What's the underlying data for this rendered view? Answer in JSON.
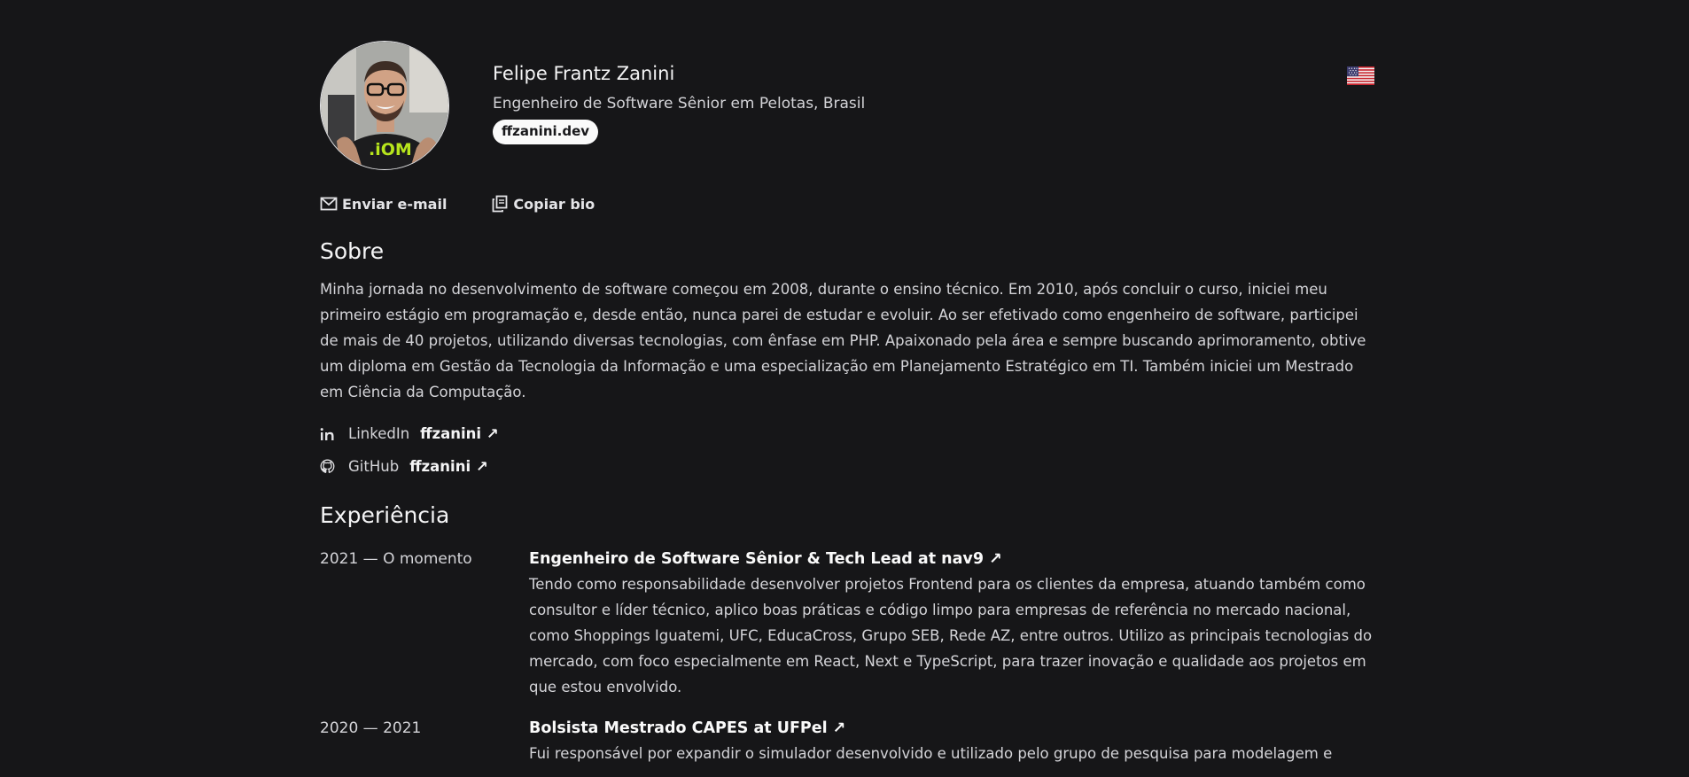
{
  "profile": {
    "name": "Felipe Frantz Zanini",
    "role": "Engenheiro de Software Sênior em Pelotas, Brasil",
    "site": "ffzanini.dev",
    "language_icon": "us-flag-icon"
  },
  "actions": {
    "email_label": "Enviar e-mail",
    "copy_label": "Copiar bio"
  },
  "about": {
    "title": "Sobre",
    "text": "Minha jornada no desenvolvimento de software começou em 2008, durante o ensino técnico. Em 2010, após concluir o curso, iniciei meu primeiro estágio em programação e, desde então, nunca parei de estudar e evoluir. Ao ser efetivado como engenheiro de software, participei de mais de 40 projetos, utilizando diversas tecnologias, com ênfase em PHP. Apaixonado pela área e sempre buscando aprimoramento, obtive um diploma em Gestão da Tecnologia da Informação e uma especialização em Planejamento Estratégico em TI. Também iniciei um Mestrado em Ciência da Computação."
  },
  "social": [
    {
      "name": "LinkedIn",
      "handle": "ffzanini ↗",
      "icon": "linkedin-icon"
    },
    {
      "name": "GitHub",
      "handle": "ffzanini ↗",
      "icon": "github-icon"
    }
  ],
  "experience": {
    "title": "Experiência",
    "items": [
      {
        "date": "2021 — O momento",
        "heading": "Engenheiro de Software Sênior & Tech Lead at nav9 ↗",
        "description": "Tendo como responsabilidade desenvolver projetos Frontend para os clientes da empresa, atuando também como consultor e líder técnico, aplico boas práticas e código limpo para empresas de referência no mercado nacional, como Shoppings Iguatemi, UFC, EducaCross, Grupo SEB, Rede AZ, entre outros. Utilizo as principais tecnologias do mercado, com foco especialmente em React, Next e TypeScript, para trazer inovação e qualidade aos projetos em que estou envolvido."
      },
      {
        "date": "2020 — 2021",
        "heading": "Bolsista Mestrado CAPES at UFPel ↗",
        "description": "Fui responsável por expandir o simulador desenvolvido e utilizado pelo grupo de pesquisa para modelagem e"
      }
    ]
  },
  "colors": {
    "background": "#161618",
    "text": "#e4e4e7",
    "pill_bg": "#fafafa"
  }
}
